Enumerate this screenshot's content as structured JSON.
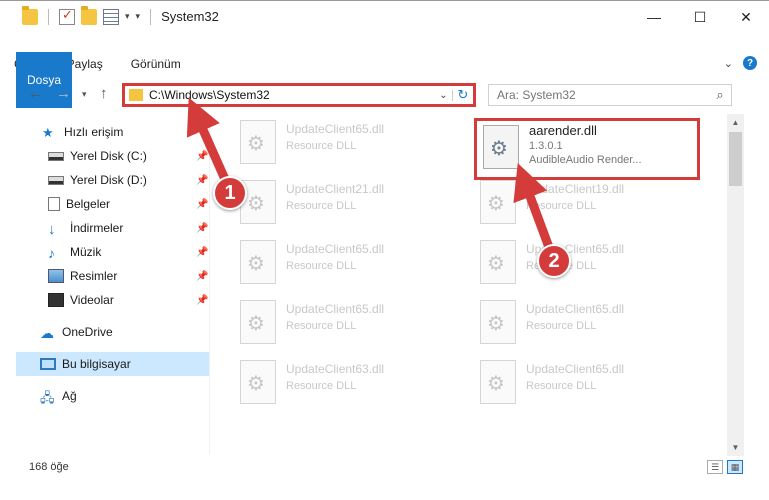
{
  "window": {
    "title": "System32",
    "controls": {
      "minimize": "—",
      "maximize": "☐",
      "close": "✕"
    }
  },
  "ribbon": {
    "tabs": [
      "Dosya",
      "Giriş",
      "Paylaş",
      "Görünüm"
    ],
    "expand_glyph": "⌄",
    "help_glyph": "?"
  },
  "address": {
    "path": "C:\\Windows\\System32",
    "search_placeholder": "Ara: System32"
  },
  "nav": {
    "items": [
      {
        "label": "Hızlı erişim",
        "icon": "star-icon",
        "pinned": false
      },
      {
        "label": "Yerel Disk (C:)",
        "icon": "drive-icon",
        "pinned": true
      },
      {
        "label": "Yerel Disk (D:)",
        "icon": "drive-icon",
        "pinned": true
      },
      {
        "label": "Belgeler",
        "icon": "documents-icon",
        "pinned": true
      },
      {
        "label": "İndirmeler",
        "icon": "download-icon",
        "pinned": true
      },
      {
        "label": "Müzik",
        "icon": "music-icon",
        "pinned": true
      },
      {
        "label": "Resimler",
        "icon": "pictures-icon",
        "pinned": true
      },
      {
        "label": "Videolar",
        "icon": "videos-icon",
        "pinned": true
      },
      {
        "label": "OneDrive",
        "icon": "cloud-icon",
        "pinned": false
      },
      {
        "label": "Bu bilgisayar",
        "icon": "computer-icon",
        "pinned": false,
        "selected": true
      },
      {
        "label": "Ağ",
        "icon": "network-icon",
        "pinned": false
      }
    ]
  },
  "files": {
    "left": [
      {
        "name": "UpdateClient65.dll",
        "type": "Resource DLL"
      },
      {
        "name": "UpdateClient21.dll",
        "type": "Resource DLL"
      },
      {
        "name": "UpdateClient65.dll",
        "type": "Resource DLL"
      },
      {
        "name": "UpdateClient65.dll",
        "type": "Resource DLL"
      },
      {
        "name": "UpdateClient63.dll",
        "type": "Resource DLL"
      }
    ],
    "highlighted": {
      "name": "aarender.dll",
      "version": "1.3.0.1",
      "type": "AudibleAudio Render..."
    },
    "right": [
      {
        "name": "UpdateClient19.dll",
        "type": "Resource DLL"
      },
      {
        "name": "UpdateClient65.dll",
        "type": "Resource DLL"
      },
      {
        "name": "UpdateClient65.dll",
        "type": "Resource DLL"
      },
      {
        "name": "UpdateClient65.dll",
        "type": "Resource DLL"
      }
    ]
  },
  "status": {
    "count": "168 öğe"
  },
  "callouts": [
    "1",
    "2"
  ],
  "colors": {
    "accent": "#1979ca",
    "highlight": "#d43c3c",
    "selection": "#cce8ff"
  }
}
